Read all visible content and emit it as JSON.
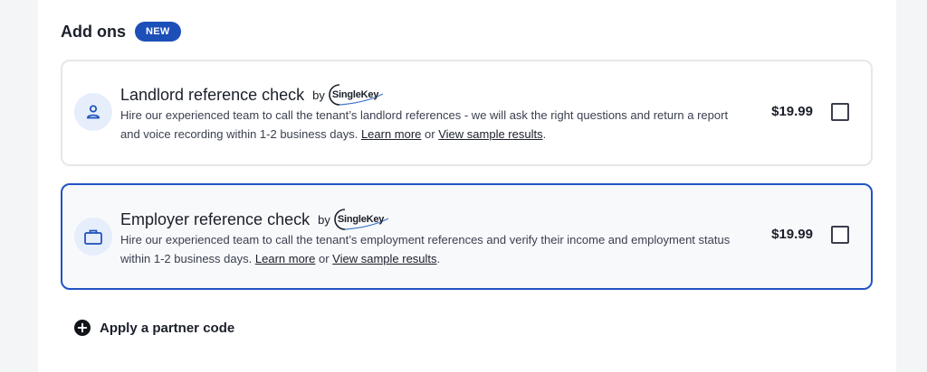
{
  "addons": {
    "title": "Add ons",
    "badge": "NEW",
    "items": [
      {
        "title": "Landlord reference check",
        "by": "by",
        "brand": "SingleKey",
        "desc_prefix": "Hire our experienced team to call the tenant’s landlord references - we will ask the right questions and return a report and voice recording within 1-2 business days.",
        "learn_more": "Learn more",
        "or": "or",
        "view_sample": "View sample results",
        "period": ".",
        "price": "$19.99",
        "icon": "person-icon"
      },
      {
        "title": "Employer reference check",
        "by": "by",
        "brand": "SingleKey",
        "desc_prefix": "Hire our experienced team to call the tenant’s employment references and verify their income and employment status within 1-2 business days.",
        "learn_more": "Learn more",
        "or": "or",
        "view_sample": "View sample results",
        "period": ".",
        "price": "$19.99",
        "icon": "briefcase-icon"
      }
    ]
  },
  "partner": {
    "label": "Apply a partner code",
    "icon": "plus-circle-icon"
  },
  "colors": {
    "accent": "#1c4fb8",
    "selected_border": "#2253c4",
    "icon_bg": "#e6edfb"
  }
}
